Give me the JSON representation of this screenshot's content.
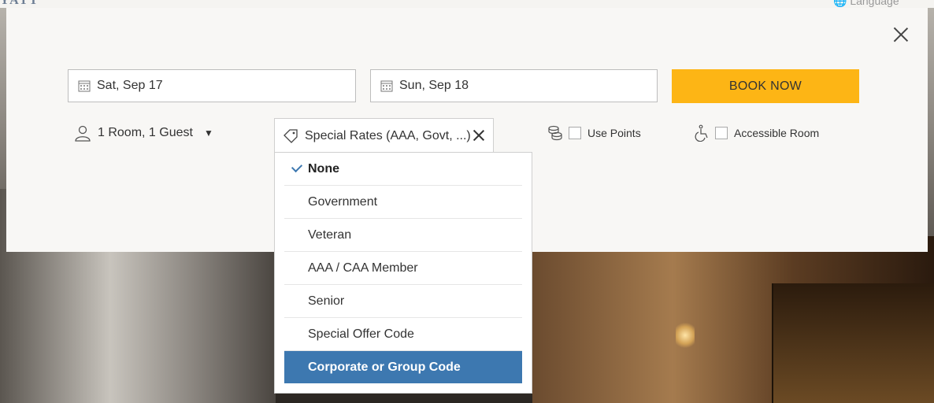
{
  "header": {
    "logo_text": "YATT",
    "language_label": "Language"
  },
  "booking": {
    "checkin": "Sat, Sep 17",
    "checkout": "Sun, Sep 18",
    "book_label": "BOOK NOW",
    "rooms_guests": "1 Room, 1 Guest",
    "special_rates_label": "Special Rates (AAA, Govt, ...)",
    "use_points_label": "Use Points",
    "accessible_label": "Accessible Room"
  },
  "rates_menu": {
    "items": [
      {
        "label": "None"
      },
      {
        "label": "Government"
      },
      {
        "label": "Veteran"
      },
      {
        "label": "AAA / CAA Member"
      },
      {
        "label": "Senior"
      },
      {
        "label": "Special Offer Code"
      },
      {
        "label": "Corporate or Group Code"
      }
    ],
    "selected_index": 0,
    "highlighted_index": 6,
    "highlight_color": "#3d78b0"
  },
  "colors": {
    "book_button": "#fdb515"
  }
}
